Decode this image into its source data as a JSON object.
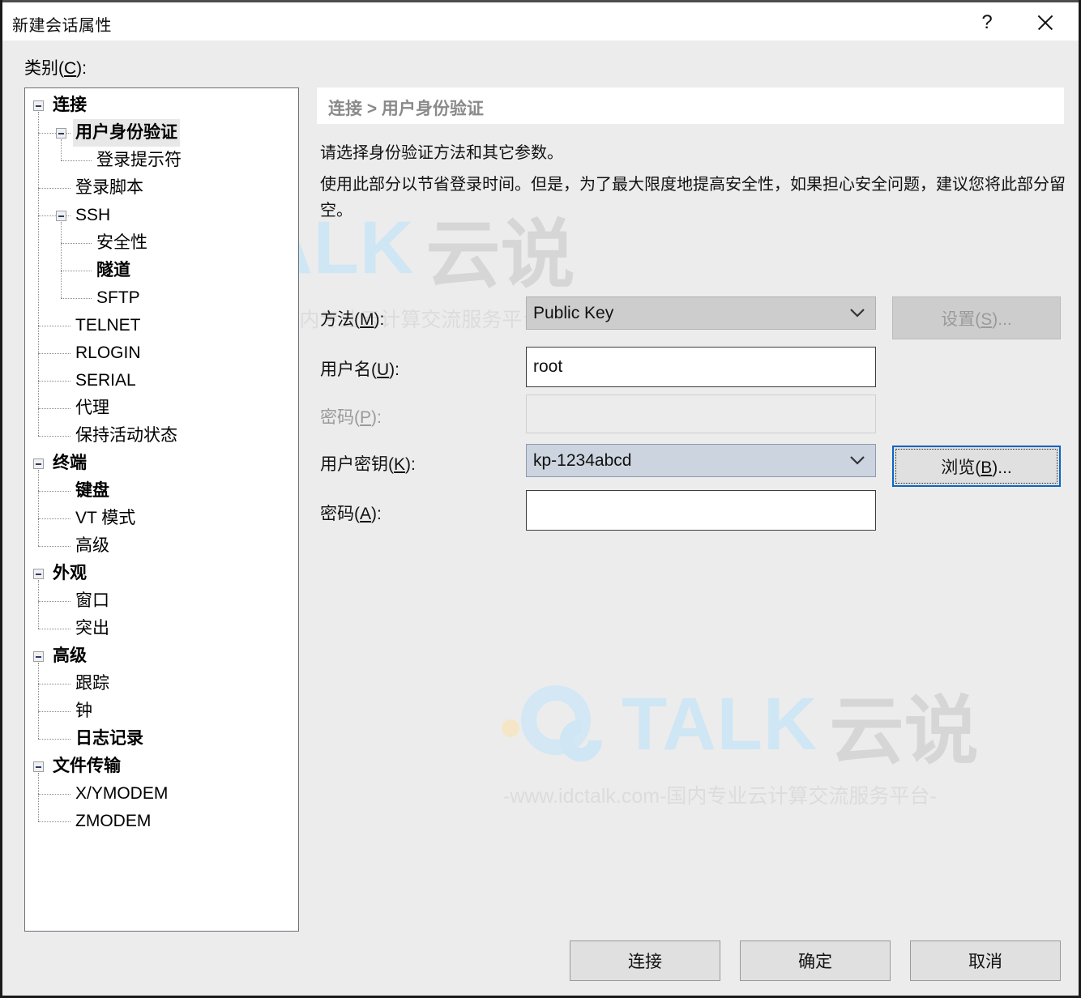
{
  "window": {
    "title": "新建会话属性",
    "help_label": "?",
    "close_label": "×"
  },
  "category": {
    "label_pre": "类别(",
    "label_acc": "C",
    "label_post": "):"
  },
  "tree": {
    "items": [
      {
        "label": "连接",
        "level": 0,
        "bold": true,
        "selected": false,
        "expander": true
      },
      {
        "label": "用户身份验证",
        "level": 1,
        "bold": true,
        "selected": true,
        "expander": true
      },
      {
        "label": "登录提示符",
        "level": 2,
        "bold": false,
        "selected": false,
        "expander": false
      },
      {
        "label": "登录脚本",
        "level": 1,
        "bold": false,
        "selected": false,
        "expander": false
      },
      {
        "label": "SSH",
        "level": 1,
        "bold": false,
        "selected": false,
        "expander": true
      },
      {
        "label": "安全性",
        "level": 2,
        "bold": false,
        "selected": false,
        "expander": false
      },
      {
        "label": "隧道",
        "level": 2,
        "bold": true,
        "selected": false,
        "expander": false
      },
      {
        "label": "SFTP",
        "level": 2,
        "bold": false,
        "selected": false,
        "expander": false
      },
      {
        "label": "TELNET",
        "level": 1,
        "bold": false,
        "selected": false,
        "expander": false
      },
      {
        "label": "RLOGIN",
        "level": 1,
        "bold": false,
        "selected": false,
        "expander": false
      },
      {
        "label": "SERIAL",
        "level": 1,
        "bold": false,
        "selected": false,
        "expander": false
      },
      {
        "label": "代理",
        "level": 1,
        "bold": false,
        "selected": false,
        "expander": false
      },
      {
        "label": "保持活动状态",
        "level": 1,
        "bold": false,
        "selected": false,
        "expander": false
      },
      {
        "label": "终端",
        "level": 0,
        "bold": true,
        "selected": false,
        "expander": true
      },
      {
        "label": "键盘",
        "level": 1,
        "bold": true,
        "selected": false,
        "expander": false
      },
      {
        "label": "VT 模式",
        "level": 1,
        "bold": false,
        "selected": false,
        "expander": false
      },
      {
        "label": "高级",
        "level": 1,
        "bold": false,
        "selected": false,
        "expander": false
      },
      {
        "label": "外观",
        "level": 0,
        "bold": true,
        "selected": false,
        "expander": true
      },
      {
        "label": "窗口",
        "level": 1,
        "bold": false,
        "selected": false,
        "expander": false
      },
      {
        "label": "突出",
        "level": 1,
        "bold": false,
        "selected": false,
        "expander": false
      },
      {
        "label": "高级",
        "level": 0,
        "bold": true,
        "selected": false,
        "expander": true
      },
      {
        "label": "跟踪",
        "level": 1,
        "bold": false,
        "selected": false,
        "expander": false
      },
      {
        "label": "钟",
        "level": 1,
        "bold": false,
        "selected": false,
        "expander": false
      },
      {
        "label": "日志记录",
        "level": 1,
        "bold": true,
        "selected": false,
        "expander": false
      },
      {
        "label": "文件传输",
        "level": 0,
        "bold": true,
        "selected": false,
        "expander": true
      },
      {
        "label": "X/YMODEM",
        "level": 1,
        "bold": false,
        "selected": false,
        "expander": false
      },
      {
        "label": "ZMODEM",
        "level": 1,
        "bold": false,
        "selected": false,
        "expander": false
      }
    ]
  },
  "panel": {
    "breadcrumb": "连接 > 用户身份验证",
    "description_line1": "请选择身份验证方法和其它参数。",
    "description_line2": "使用此部分以节省登录时间。但是，为了最大限度地提高安全性，如果担心安全问题，建议您将此部分留空。"
  },
  "form": {
    "method": {
      "label_pre": "方法(",
      "label_acc": "M",
      "label_post": "):",
      "value": "Public Key",
      "chevron": "chevron-down-icon"
    },
    "username": {
      "label_pre": "用户名(",
      "label_acc": "U",
      "label_post": "):",
      "value": "root",
      "placeholder": ""
    },
    "password": {
      "label_pre": "密码(",
      "label_acc": "P",
      "label_post": "):",
      "value": "",
      "placeholder": "",
      "disabled": true
    },
    "userkey": {
      "label_pre": "用户密钥(",
      "label_acc": "K",
      "label_post": "):",
      "value": "kp-1234abcd",
      "chevron": "chevron-down-icon"
    },
    "passphrase": {
      "label_pre": "密码(",
      "label_acc": "A",
      "label_post": "):",
      "value": "",
      "placeholder": ""
    },
    "settings_button": {
      "label_pre": "设置(",
      "label_acc": "S",
      "label_post": ")...",
      "disabled": true
    },
    "browse_button": {
      "label_pre": "浏览(",
      "label_acc": "B",
      "label_post": ")...",
      "focused": true
    }
  },
  "footer": {
    "connect": "连接",
    "ok": "确定",
    "cancel": "取消"
  },
  "watermark": {
    "brand_talk": "TALK",
    "brand_yun": "云说",
    "url": "-www.idctalk.com-国内专业云计算交流服务平台-"
  },
  "colors": {
    "dialog_bg": "#ececec",
    "panel_white": "#ffffff",
    "accent_focus": "#0a64c8",
    "tree_selection": "#e8e8e8",
    "disabled_text": "#9a9a9a",
    "breadcrumb_text": "#8a8a8a",
    "watermark_blue": "#d3e7f5",
    "watermark_gray": "#d6d6d6"
  }
}
